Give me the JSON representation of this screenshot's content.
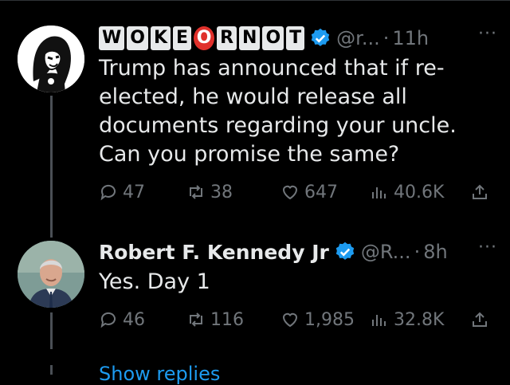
{
  "tweets": [
    {
      "handle": "@r...",
      "time": "11h",
      "text": "Trump has announced that if re-elected, he would release all documents regarding your uncle. Can you promise the same?",
      "logo_tiles": [
        "W",
        "O",
        "K",
        "E",
        "O",
        "R",
        "N",
        "O",
        "T"
      ],
      "stats": {
        "replies": "47",
        "retweets": "38",
        "likes": "647",
        "views": "40.6K"
      }
    },
    {
      "name": "Robert F. Kennedy Jr",
      "handle": "@R...",
      "time": "8h",
      "text": "Yes. Day 1",
      "stats": {
        "replies": "46",
        "retweets": "116",
        "likes": "1,985",
        "views": "32.8K"
      }
    }
  ],
  "separator": "·",
  "more_glyph": "···",
  "show_more": "Show replies",
  "colors": {
    "accent": "#1d9bf0",
    "muted": "#71767b",
    "text": "#e7e9ea"
  }
}
